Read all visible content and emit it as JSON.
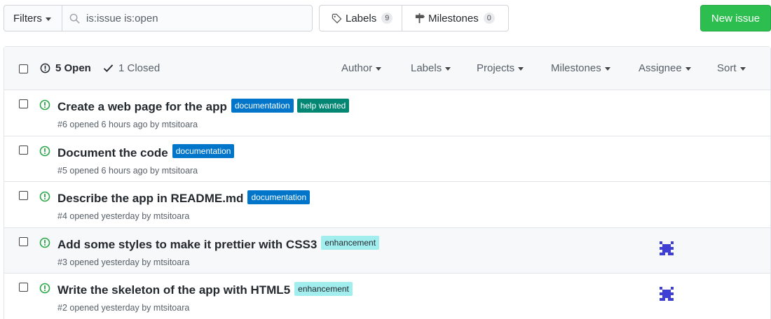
{
  "topbar": {
    "filters_label": "Filters",
    "search_value": "is:issue is:open",
    "labels_button": "Labels",
    "labels_count": "9",
    "milestones_button": "Milestones",
    "milestones_count": "0",
    "new_issue_label": "New issue"
  },
  "header": {
    "open_label": "5 Open",
    "closed_label": "1 Closed",
    "filters": [
      "Author",
      "Labels",
      "Projects",
      "Milestones",
      "Assignee",
      "Sort"
    ]
  },
  "colors": {
    "documentation": "#0075ca",
    "help_wanted": "#008672",
    "enhancement": "#a2eeef",
    "open_icon": "#28a745"
  },
  "issues": [
    {
      "title": "Create a web page for the app",
      "labels": [
        "documentation",
        "help wanted"
      ],
      "meta": "#6 opened 6 hours ago by mtsitoara"
    },
    {
      "title": "Document the code",
      "labels": [
        "documentation"
      ],
      "meta": "#5 opened 6 hours ago by mtsitoara"
    },
    {
      "title": "Describe the app in README.md",
      "labels": [
        "documentation"
      ],
      "meta": "#4 opened yesterday by mtsitoara"
    },
    {
      "title": "Add some styles to make it prettier with CSS3",
      "labels": [
        "enhancement"
      ],
      "meta": "#3 opened yesterday by mtsitoara"
    },
    {
      "title": "Write the skeleton of the app with HTML5",
      "labels": [
        "enhancement"
      ],
      "meta": "#2 opened yesterday by mtsitoara"
    }
  ]
}
